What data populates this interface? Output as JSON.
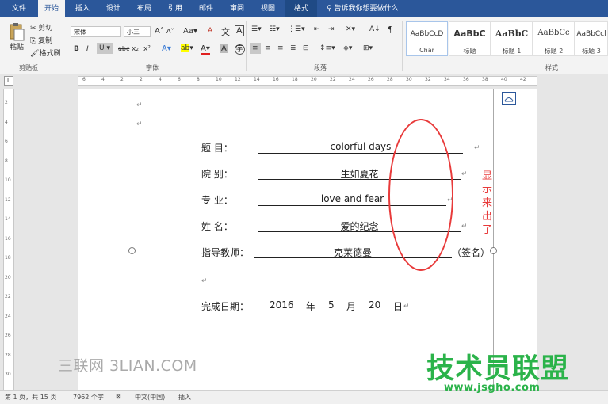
{
  "tabs": [
    "文件",
    "开始",
    "插入",
    "设计",
    "布局",
    "引用",
    "邮件",
    "审阅",
    "视图",
    "格式"
  ],
  "tell_me": "告诉我你想要做什么",
  "clipboard": {
    "paste": "粘贴",
    "cut": "剪切",
    "copy": "复制",
    "format_painter": "格式刷",
    "group": "剪贴板"
  },
  "font": {
    "name": "宋体",
    "size": "小三",
    "aa": "Aa",
    "wen": "文",
    "grow": "A",
    "shrink": "A",
    "clear": "A",
    "bold": "B",
    "italic": "I",
    "underline": "U",
    "strike": "abc",
    "sub": "x₂",
    "sup": "x²",
    "effects": "A",
    "highlight": "ab",
    "color": "A",
    "shade": "A",
    "border": "A",
    "group": "字体"
  },
  "paragraph": {
    "sort": "A↓",
    "mark": "¶",
    "group": "段落"
  },
  "styles": {
    "items": [
      {
        "sample": "AaBbCcD",
        "name": "Char"
      },
      {
        "sample": "AaBbC",
        "name": "标题"
      },
      {
        "sample": "AaBbC",
        "name": "标题 1"
      },
      {
        "sample": "AaBbCc",
        "name": "标题 2"
      },
      {
        "sample": "AaBbCcl",
        "name": "标题 3"
      }
    ],
    "group": "样式"
  },
  "ruler_corner": "L",
  "hruler_ticks": [
    "6",
    "4",
    "2",
    "2",
    "4",
    "6",
    "8",
    "10",
    "12",
    "14",
    "16",
    "18",
    "20",
    "22",
    "24",
    "26",
    "28",
    "30",
    "32",
    "34",
    "36",
    "38",
    "40",
    "42"
  ],
  "vruler_ticks": [
    "2",
    "4",
    "6",
    "8",
    "10",
    "12",
    "14",
    "16",
    "18",
    "20",
    "22",
    "24",
    "26",
    "28",
    "30"
  ],
  "document": {
    "lines": [
      {
        "label": "题    目：",
        "value": "colorful days"
      },
      {
        "label": "院    别：",
        "value": "生如夏花"
      },
      {
        "label": "专    业：",
        "value": "love and fear"
      },
      {
        "label": "姓    名：",
        "value": "爱的纪念"
      },
      {
        "label": "指导教师：",
        "value": "克莱德曼",
        "suffix": "（签名）"
      }
    ],
    "date_label": "完成日期：",
    "date_parts": [
      "2016",
      "年",
      "5",
      "月",
      "20",
      "日"
    ],
    "para_mark": "↵"
  },
  "annotation": {
    "text": "显示来出了",
    "color": "#e83a3a"
  },
  "watermarks": {
    "left": "三联网 3LIAN.COM",
    "right_title": "技术员联盟",
    "right_url": "www.jsgho.com",
    "green": "#2bb34a"
  },
  "status": {
    "page": "第 1 页，共 15 页",
    "words": "7962 个字",
    "lang": "中文(中国)",
    "mode": "插入"
  },
  "colors": {
    "accent": "#2b579a"
  }
}
